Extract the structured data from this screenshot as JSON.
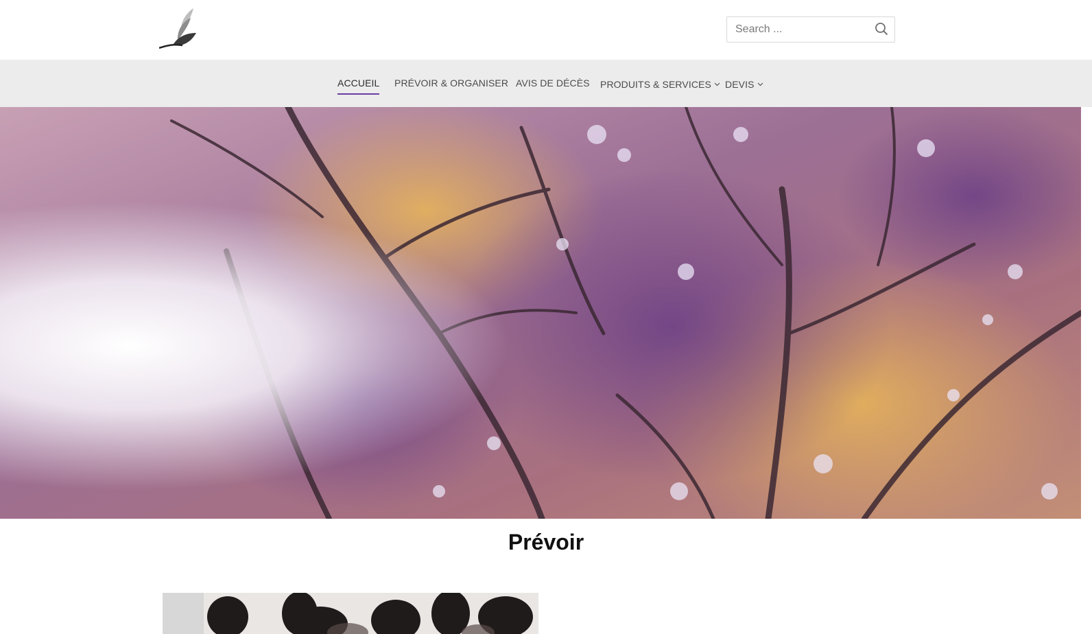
{
  "header": {
    "logo_icon": "leaf-logo-icon",
    "search": {
      "placeholder": "Search ...",
      "value": "",
      "icon": "search-icon"
    }
  },
  "nav": {
    "items": [
      {
        "label": "ACCUEIL",
        "active": true
      },
      {
        "label": "PRÉVOIR & ORGANISER",
        "active": false
      },
      {
        "label": "AVIS DE DÉCÈS",
        "active": false
      },
      {
        "label": "PRODUITS & SERVICES",
        "active": false,
        "has_dropdown": true
      },
      {
        "label": "DEVIS",
        "active": false,
        "has_dropdown": true
      }
    ],
    "accent_color": "#6a3ea1"
  },
  "main": {
    "section_title": "Prévoir"
  }
}
